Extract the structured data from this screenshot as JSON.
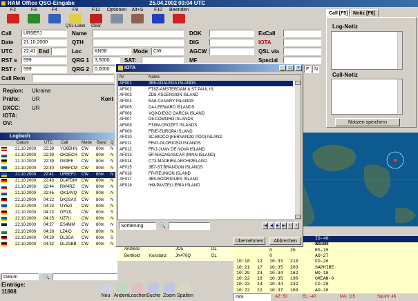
{
  "window": {
    "title": "HAM Office  QSO-Eingabe",
    "date": "25.04.2002",
    "time": "00:04 UTC"
  },
  "toolbar": {
    "items": [
      {
        "key": "F2",
        "icon": "clock-icon",
        "color": "#d42020",
        "label": ""
      },
      {
        "key": "F3",
        "icon": "globe-icon",
        "color": "#2a8a2a",
        "label": ""
      },
      {
        "key": "F4",
        "icon": "user-icon",
        "color": "#3060c0",
        "label": ""
      },
      {
        "key": "F9",
        "icon": "qsl-label-icon",
        "color": "#e0d040",
        "label": "QSL-Label"
      },
      {
        "key": "F12",
        "icon": "clear-icon",
        "color": "#c02020",
        "label": "Clear"
      },
      {
        "key": "Optionen",
        "icon": "tools-icon",
        "color": "#8090a0",
        "label": ""
      },
      {
        "key": "Alt+S",
        "icon": "keyboard-icon",
        "color": "#906050",
        "label": ""
      },
      {
        "key": "F10",
        "icon": "exit-door-icon",
        "color": "#2040c0",
        "label": ""
      },
      {
        "key": "Beenden",
        "icon": "close-x-icon",
        "color": "#d02020",
        "label": ""
      }
    ]
  },
  "form": {
    "call": {
      "label": "Call",
      "value": "UR5EFJ"
    },
    "date": {
      "label": "Date",
      "value": "21.10.2000"
    },
    "utc": {
      "label": "UTC",
      "value": "22:41",
      "end_label": "End"
    },
    "rst_s": {
      "label": "RST s",
      "value": "599"
    },
    "rst_r": {
      "label": "RST r",
      "value": "599"
    },
    "call_rem": {
      "label": "Call Rem"
    },
    "name": {
      "label": "Name",
      "value": ""
    },
    "qth": {
      "label": "QTH",
      "value": ""
    },
    "loc": {
      "label": "Loc",
      "value": "KN58"
    },
    "mode": {
      "label": "Mode",
      "value": "CW"
    },
    "qrg1": {
      "label": "QRG 1",
      "value": "3,5000"
    },
    "qrg2": {
      "label": "QRG 2",
      "value": "0,0000"
    },
    "sat": {
      "label": "SAT:"
    },
    "dok": {
      "label": "DOK"
    },
    "dig": {
      "label": "DIG"
    },
    "agcw": {
      "label": "AGCW"
    },
    "mf": {
      "label": "MF"
    },
    "excall": {
      "label": "ExCall"
    },
    "iota": {
      "label": "IOTA"
    },
    "qsl_via": {
      "label": "QSL via"
    },
    "special": {
      "label": "Special"
    },
    "f_field": "F",
    "n_field": "N"
  },
  "tabs": {
    "call": "Call [F5]",
    "notiz": "Notiz [F6]"
  },
  "notes": {
    "log_notiz": "Log-Notiz",
    "call_notiz": "Call-Notiz",
    "save": "Notizen speichern"
  },
  "info": {
    "region_label": "Region:",
    "region_value": "Ukraine",
    "praefix_label": "Präfix:",
    "praefix_value": "UR",
    "dxcc_label": "DXCC:",
    "dxcc_value": "UR",
    "iota_label": "IOTA:",
    "ov_label": "OV:",
    "kont_label": "Kont"
  },
  "logbuch": {
    "title": "Logbuch",
    "columns": [
      "Datum",
      "UTC",
      "Call",
      "Mode",
      "Band",
      "Q"
    ],
    "rows": [
      {
        "d": "21.10.2000",
        "t": "22:38",
        "c": "YO6BHN",
        "m": "CW",
        "b": "80m",
        "q": "N",
        "flag": "ro",
        "sel": false
      },
      {
        "d": "21.10.2000",
        "t": "22:39",
        "c": "OK2ECH",
        "m": "CW",
        "b": "80m",
        "q": "N",
        "flag": "cz",
        "sel": false
      },
      {
        "d": "21.10.2000",
        "t": "22:39",
        "c": "DK9FE",
        "m": "CW",
        "b": "80m",
        "q": "N",
        "flag": "de",
        "sel": false
      },
      {
        "d": "21.10.2000",
        "t": "22:40",
        "c": "UR5FCM",
        "m": "CW",
        "b": "80m",
        "q": "N",
        "flag": "ua",
        "sel": false
      },
      {
        "d": "21.10.2000",
        "t": "22:41",
        "c": "UR5EFJ",
        "m": "CW",
        "b": "80m",
        "q": "N",
        "flag": "ua",
        "sel": true
      },
      {
        "d": "21.10.2000",
        "t": "22:43",
        "c": "DL4FDM",
        "m": "CW",
        "b": "80m",
        "q": "N",
        "flag": "de",
        "sel": false
      },
      {
        "d": "21.10.2000",
        "t": "22:44",
        "c": "RW4RZ",
        "m": "CW",
        "b": "80m",
        "q": "N",
        "flag": "ru",
        "sel": false
      },
      {
        "d": "21.10.2000",
        "t": "22:45",
        "c": "OK1AVQ",
        "m": "CW",
        "b": "80m",
        "q": "N",
        "flag": "cz",
        "sel": false
      },
      {
        "d": "22.10.2000",
        "t": "04:22",
        "c": "DK0SAX",
        "m": "CW",
        "b": "80m",
        "q": "N",
        "flag": "de",
        "sel": false
      },
      {
        "d": "22.10.2000",
        "t": "04:23",
        "c": "UY5ZI",
        "m": "CW",
        "b": "80m",
        "q": "N",
        "flag": "ua",
        "sel": false
      },
      {
        "d": "22.10.2000",
        "t": "04:23",
        "c": "DF0JL",
        "m": "CW",
        "b": "80m",
        "q": "S",
        "flag": "de",
        "sel": false
      },
      {
        "d": "22.10.2000",
        "t": "04:25",
        "c": "UZ7U",
        "m": "CW",
        "b": "80m",
        "q": "N",
        "flag": "ua",
        "sel": false
      },
      {
        "d": "22.10.2000",
        "t": "04:27",
        "c": "ES4MM",
        "m": "CW",
        "b": "80m",
        "q": "N",
        "flag": "ee",
        "sel": false
      },
      {
        "d": "22.10.2000",
        "t": "04:28",
        "c": "LZ4/O",
        "m": "CW",
        "b": "80m",
        "q": "N",
        "flag": "bg",
        "sel": false
      },
      {
        "d": "22.10.2000",
        "t": "04:29",
        "c": "DL3GA",
        "m": "CW",
        "b": "80m",
        "q": "S",
        "flag": "de",
        "sel": false
      },
      {
        "d": "22.10.2000",
        "t": "04:32",
        "c": "DL2GBB",
        "m": "CW",
        "b": "80m",
        "q": "N",
        "flag": "de",
        "sel": false
      }
    ],
    "extra_row": {
      "name": "Berthold",
      "qth": "Konstanz",
      "loc": "JN470Q",
      "x": "DL"
    },
    "extra_row_above": {
      "name": "Andreas",
      "qth": "",
      "loc": "JO5",
      "x": "DL"
    },
    "search_field": "Datum",
    "entries_label": "Einträge:",
    "entries_value": "11808"
  },
  "bottom": {
    "buttons": [
      {
        "label": "Neu",
        "icon": "new-icon"
      },
      {
        "label": "Andern",
        "icon": "edit-icon"
      },
      {
        "label": "Loschen",
        "icon": "delete-icon"
      },
      {
        "label": "Suche",
        "icon": "search-icon"
      },
      {
        "label": "Zoom",
        "icon": "zoom-icon"
      },
      {
        "label": "Spalten",
        "icon": "columns-icon"
      }
    ]
  },
  "iota_dialog": {
    "title": "IOTA",
    "columns": [
      "Nr",
      "Name"
    ],
    "rows": [
      {
        "nr": "AF001",
        "name": "3B6-AGALEGA ISLANDS",
        "sel": true
      },
      {
        "nr": "AF002",
        "name": "FT8Z-AMSTERDAM & ST PAUL IS.",
        "sel": false
      },
      {
        "nr": "AF003",
        "name": "ZD8-ASCENSION ISLAND",
        "sel": false
      },
      {
        "nr": "AF004",
        "name": "EA8-CANARY ISLANDS",
        "sel": false
      },
      {
        "nr": "AF005",
        "name": "D4-LEEWARD ISLANDS",
        "sel": false
      },
      {
        "nr": "AF006",
        "name": "VQ9-DIEGO GARCIA ISLAND",
        "sel": false
      },
      {
        "nr": "AF007",
        "name": "D6-COMORO ISLANDS",
        "sel": false
      },
      {
        "nr": "AF008",
        "name": "FT8W-CROZET ISLANDS",
        "sel": false
      },
      {
        "nr": "AF009",
        "name": "FR/E-EUROPA ISLAND",
        "sel": false
      },
      {
        "nr": "AF010",
        "name": "3C-BIOCO (FERNANDO POO) ISLAND",
        "sel": false
      },
      {
        "nr": "AF011",
        "name": "FR/G-GLORIOSO ISLANDS",
        "sel": false
      },
      {
        "nr": "AF012",
        "name": "FR/J-JUAN DE NOVA ISLAND",
        "sel": false
      },
      {
        "nr": "AF013",
        "name": "5R-MADAGASCAR (MAIN ISLAND)",
        "sel": false
      },
      {
        "nr": "AF014",
        "name": "CT3-MADEIRA ARCHIPELAGO",
        "sel": false
      },
      {
        "nr": "AF015",
        "name": "3B7-ST.BRANDON ISLANDS",
        "sel": false
      },
      {
        "nr": "AF016",
        "name": "FR-REUNION ISLAND",
        "sel": false
      },
      {
        "nr": "AF017",
        "name": "3B9-RODRIGUES ISLAND",
        "sel": false
      },
      {
        "nr": "AF018",
        "name": "IH9-PANTELLERIA ISLAND",
        "sel": false
      }
    ],
    "sort_field": "Sortierung",
    "ok": "Übernehmen",
    "cancel": "Abbrechen"
  },
  "satellites": {
    "header": {
      "c1": "g",
      "c2": "Satellit"
    },
    "rows": [
      {
        "a": "",
        "b": "",
        "c": "0",
        "d": "",
        "e": "IO-40",
        "sel": true
      },
      {
        "a": "",
        "b": "",
        "c": "0",
        "d": "",
        "e": "AO-27",
        "sel": false
      },
      {
        "a": "",
        "b": "",
        "c": "0",
        "d": "26",
        "e": "RS-15",
        "sel": false
      },
      {
        "a": "",
        "b": "",
        "c": "0",
        "d": "",
        "e": "AO-27",
        "sel": false
      },
      {
        "a": "10:18",
        "b": "12",
        "c": "10:33",
        "d": "210",
        "e": "FO-26",
        "sel": false
      },
      {
        "a": "10:21",
        "b": "17",
        "c": "10:35",
        "d": "203",
        "e": "SAPHIRE",
        "sel": false
      },
      {
        "a": "10:29",
        "b": "24",
        "c": "10:34",
        "d": "162",
        "e": "WO-18",
        "sel": false
      },
      {
        "a": "10:22",
        "b": "16",
        "c": "10:35",
        "d": "190",
        "e": "OKEAN-0",
        "sel": false
      },
      {
        "a": "10:23",
        "b": "14",
        "c": "10:34",
        "d": "232",
        "e": "FO-20",
        "sel": false
      },
      {
        "a": "10:22",
        "b": "22",
        "c": "10:37",
        "d": "169",
        "e": "AO-16",
        "sel": false
      }
    ],
    "status": {
      "sel": "ISS",
      "az": "AZ: 50",
      "el": "EL: -40",
      "ma": "MA: 115",
      "squint": "Squint: 46"
    }
  }
}
